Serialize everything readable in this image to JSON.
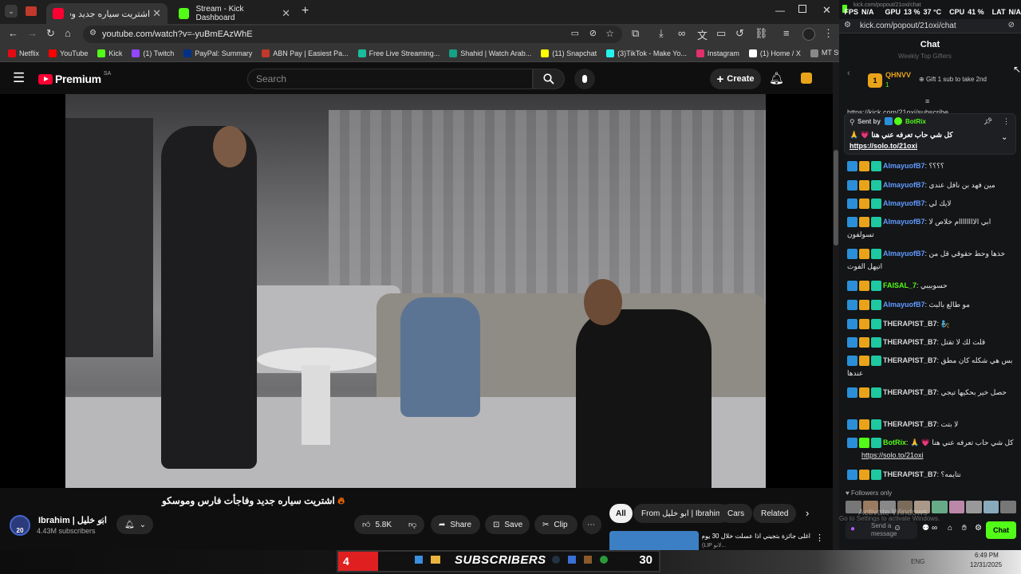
{
  "browser": {
    "tabs": [
      {
        "label": "اشتريت سياره جديد وفاجأت",
        "favicon_color": "#ff0033"
      },
      {
        "label": "Stream - Kick Dashboard",
        "favicon_color": "#53fc18"
      }
    ],
    "new_tab": "+",
    "url": "youtube.com/watch?v=-yuBmEAzWhE",
    "bookmarks": [
      {
        "label": "Netflix",
        "color": "#e50914"
      },
      {
        "label": "YouTube",
        "color": "#ff0000"
      },
      {
        "label": "Kick",
        "color": "#53fc18"
      },
      {
        "label": "(1) Twitch",
        "color": "#9146ff"
      },
      {
        "label": "PayPal: Summary",
        "color": "#003087"
      },
      {
        "label": "ABN Pay | Easiest Pa...",
        "color": "#c0392b"
      },
      {
        "label": "Free Live Streaming...",
        "color": "#1abc9c"
      },
      {
        "label": "Shahid | Watch Arab...",
        "color": "#16a085"
      },
      {
        "label": "(11) Snapchat",
        "color": "#fffc00"
      },
      {
        "label": "(3)TikTok - Make Yo...",
        "color": "#25f4ee"
      },
      {
        "label": "Instagram",
        "color": "#e1306c"
      },
      {
        "label": "(1) Home / X",
        "color": "#ffffff"
      },
      {
        "label": "MT Store - مرحبًا",
        "color": "#888888"
      }
    ]
  },
  "youtube": {
    "logo": "Premium",
    "country": "SA",
    "search_placeholder": "Search",
    "create_label": "Create",
    "video_title": "اشتريت سياره جديد وفاجأت فارس وموسكو",
    "channel_name": "Ibrahim | ابو خليل",
    "subscribers": "4.43M subscribers",
    "avatar_text": "20",
    "likes": "5.8K",
    "share": "Share",
    "save": "Save",
    "clip": "Clip",
    "chips": [
      "All",
      "From ابو خليل | Ibrahim",
      "Cars",
      "Related"
    ],
    "up_next_title": "اغلى جائزة بتجيني اذا عسلت خلال 30 يوم",
    "up_next_sub": "(LIP لانو...",
    "watermark": "IB"
  },
  "overlay": {
    "fps_label": "FPS",
    "fps": "N/A",
    "gpu_label": "GPU",
    "gpu": "13 %",
    "gpu_temp": "37 °C",
    "cpu_label": "CPU",
    "cpu": "41 %",
    "lat_label": "LAT",
    "lat": "N/A"
  },
  "kick": {
    "url_hint": "kick.com/popout/21oxi/chat",
    "url": "kick.com/popout/21oxi/chat",
    "chat_title": "Chat",
    "gifters_header": "Weekly Top Gifters",
    "top_gifter": "QHNVV",
    "top_gifter_count": "1",
    "gift_cta": "Gift 1 sub to take 2nd",
    "link_peek": "https://kick.com/21oxi/subscribe",
    "pinned_sender_label": "Sent by",
    "pinned_sender": "BotRix",
    "pinned_text": "كل شي حاب تعرفه عني هنا 💗 🙏",
    "pinned_link": "https://solo.to/21oxi",
    "messages": [
      {
        "user": "AlmayuofB7",
        "color": "#5f9bff",
        "text": "؟؟؟؟"
      },
      {
        "user": "AlmayuofB7",
        "color": "#5f9bff",
        "text": "مين فهد بن نافل عندي"
      },
      {
        "user": "AlmayuofB7",
        "color": "#5f9bff",
        "text": "لايك لي"
      },
      {
        "user": "AlmayuofB7",
        "color": "#5f9bff",
        "text": "ابي الاااااااام خلاص لا تسولفون"
      },
      {
        "user": "AlmayuofB7",
        "color": "#5f9bff",
        "text": "خذها وحط حقوقي قل من اتيهل الفوت"
      },
      {
        "user": "FAISAL_7",
        "color": "#53fc18",
        "text": "حسوبيبي"
      },
      {
        "user": "AlmayuofB7",
        "color": "#5f9bff",
        "text": "مو طالع بالبث"
      },
      {
        "user": "THERAPIST_B7",
        "color": "#d8d8d8",
        "text": "🧞"
      },
      {
        "user": "THERAPIST_B7",
        "color": "#d8d8d8",
        "text": "قلت لك لا تقتل"
      },
      {
        "user": "THERAPIST_B7",
        "color": "#d8d8d8",
        "text": "بس هي شكله كان مطق عندها"
      },
      {
        "user": "THERAPIST_B7",
        "color": "#d8d8d8",
        "text": "حصل خير بحكيها تيجي"
      },
      {
        "user": "THERAPIST_B7",
        "color": "#d8d8d8",
        "text": "لا بتت"
      },
      {
        "user": "BotRix",
        "color": "#53fc18",
        "text": "كل شي حاب تعرفه عني هنا 💗 🙏",
        "link": "https://solo.to/21oxi"
      },
      {
        "user": "THERAPIST_B7",
        "color": "#d8d8d8",
        "text": "نتايمه؟"
      }
    ],
    "followers_only": "Followers only",
    "send_placeholder": "Send a message",
    "chat_button": "Chat",
    "activate": "Activate Windows",
    "activate_sub": "Go to Settings to activate Windows."
  },
  "taskbar": {
    "sub_count_left": "4",
    "sub_label": "SUBSCRIBERS",
    "sub_count_right": "30",
    "lang": "ENG",
    "time": "6:49 PM",
    "date": "12/31/2025"
  }
}
